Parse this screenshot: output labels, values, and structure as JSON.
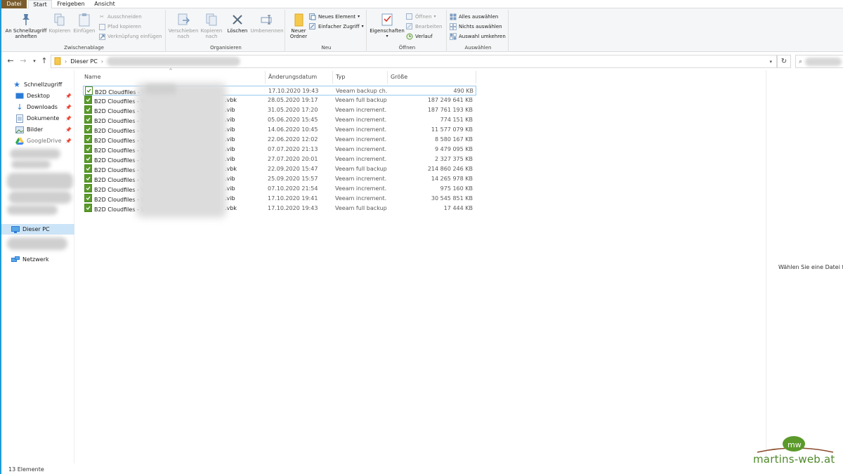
{
  "tabs": [
    {
      "label": "Datei"
    },
    {
      "label": "Start"
    },
    {
      "label": "Freigeben"
    },
    {
      "label": "Ansicht"
    }
  ],
  "ribbon": {
    "clipboard": {
      "pin_label": "An Schnellzugriff anheften",
      "copy_label": "Kopieren",
      "paste_label": "Einfügen",
      "cut_label": "Ausschneiden",
      "copy_path_label": "Pfad kopieren",
      "paste_shortcut_label": "Verknüpfung einfügen",
      "group_label": "Zwischenablage"
    },
    "organize": {
      "move_label": "Verschieben nach",
      "copyto_label": "Kopieren nach",
      "delete_label": "Löschen",
      "rename_label": "Umbenennen",
      "group_label": "Organisieren"
    },
    "new": {
      "folder_label": "Neuer Ordner",
      "new_item_label": "Neues Element",
      "easy_access_label": "Einfacher Zugriff",
      "group_label": "Neu"
    },
    "open": {
      "properties_label": "Eigenschaften",
      "open_label": "Öffnen",
      "edit_label": "Bearbeiten",
      "history_label": "Verlauf",
      "group_label": "Öffnen"
    },
    "select": {
      "select_all_label": "Alles auswählen",
      "select_none_label": "Nichts auswählen",
      "invert_label": "Auswahl umkehren",
      "group_label": "Auswählen"
    }
  },
  "address": {
    "path": "Dieser PC"
  },
  "nav": {
    "quick_access": "Schnellzugriff",
    "desktop": "Desktop",
    "downloads": "Downloads",
    "documents": "Dokumente",
    "pictures": "Bilder",
    "googledrive": "GoogleDrive",
    "this_pc": "Dieser PC",
    "network": "Netzwerk"
  },
  "columns": {
    "name": "Name",
    "date": "Änderungsdatum",
    "type": "Typ",
    "size": "Größe"
  },
  "files": [
    {
      "name": "B2D Cloudfiles - V",
      "ext": "",
      "date": "17.10.2020 19:43",
      "type": "Veeam backup ch...",
      "size": "490 KB"
    },
    {
      "name": "B2D Cloudfiles - V",
      "ext": ".vbk",
      "date": "28.05.2020 19:17",
      "type": "Veeam full backup...",
      "size": "187 249 641 KB"
    },
    {
      "name": "B2D Cloudfiles - V",
      "ext": ".vib",
      "date": "31.05.2020 17:20",
      "type": "Veeam increment...",
      "size": "187 761 193 KB"
    },
    {
      "name": "B2D Cloudfiles - V",
      "ext": ".vib",
      "date": "05.06.2020 15:45",
      "type": "Veeam increment...",
      "size": "774 151 KB"
    },
    {
      "name": "B2D Cloudfiles - V",
      "ext": ".vib",
      "date": "14.06.2020 10:45",
      "type": "Veeam increment...",
      "size": "11 577 079 KB"
    },
    {
      "name": "B2D Cloudfiles - V",
      "ext": ".vib",
      "date": "22.06.2020 12:02",
      "type": "Veeam increment...",
      "size": "8 580 167 KB"
    },
    {
      "name": "B2D Cloudfiles - V",
      "ext": ".vib",
      "date": "07.07.2020 21:13",
      "type": "Veeam increment...",
      "size": "9 479 095 KB"
    },
    {
      "name": "B2D Cloudfiles - V",
      "ext": ".vib",
      "date": "27.07.2020 20:01",
      "type": "Veeam increment...",
      "size": "2 327 375 KB"
    },
    {
      "name": "B2D Cloudfiles - V",
      "ext": ".vbk",
      "date": "22.09.2020 15:47",
      "type": "Veeam full backup...",
      "size": "214 860 246 KB"
    },
    {
      "name": "B2D Cloudfiles - V",
      "ext": ".vib",
      "date": "25.09.2020 15:57",
      "type": "Veeam increment...",
      "size": "14 265 978 KB"
    },
    {
      "name": "B2D Cloudfiles - V",
      "ext": ".vib",
      "date": "07.10.2020 21:54",
      "type": "Veeam increment...",
      "size": "975 160 KB"
    },
    {
      "name": "B2D Cloudfiles - V",
      "ext": ".vib",
      "date": "17.10.2020 19:41",
      "type": "Veeam increment...",
      "size": "30 545 851 KB"
    },
    {
      "name": "B2D Cloudfiles - V",
      "ext": ".vbk",
      "date": "17.10.2020 19:43",
      "type": "Veeam full backup...",
      "size": "17 444 KB"
    }
  ],
  "details": {
    "hint": "Wählen Sie eine Datei für d"
  },
  "status": {
    "count": "13 Elemente"
  },
  "watermark": {
    "text": "martins-web.at",
    "logo_text": "mw"
  }
}
